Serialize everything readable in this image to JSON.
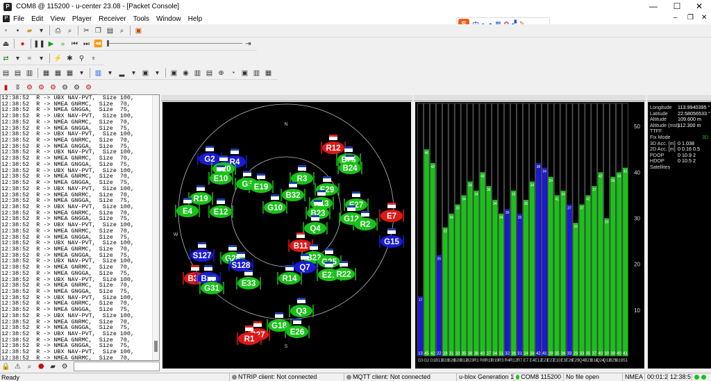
{
  "window": {
    "title": "COM8 @ 115200 - u-center 23.08 - [Packet Console]",
    "app_icon": "P",
    "minimize": "—",
    "maximize": "☐",
    "close": "✕"
  },
  "menu": {
    "items": [
      "File",
      "Edit",
      "View",
      "Player",
      "Receiver",
      "Tools",
      "Window",
      "Help"
    ],
    "mdi": {
      "minimize": "–",
      "restore": "❐",
      "close": "✕"
    }
  },
  "ime": {
    "logo": "S",
    "lang": "中"
  },
  "console": {
    "lines": [
      "12:38:52  R -> UBX NAV-PVT,  Size 100,",
      "12:38:52  R -> NMEA GNRMC,  Size  70,",
      "12:38:52  R -> NMEA GNGGA,  Size  75,",
      "12:38:52  R -> UBX NAV-PVT,  Size 100,",
      "12:38:52  R -> NMEA GNRMC,  Size  70,",
      "12:38:52  R -> NMEA GNGGA,  Size  75,",
      "12:38:52  R -> UBX NAV-PVT,  Size 100,",
      "12:38:52  R -> NMEA GNRMC,  Size  70,",
      "12:38:52  R -> NMEA GNGGA,  Size  75,",
      "12:38:52  R -> UBX NAV-PVT,  Size 100,",
      "12:38:52  R -> NMEA GNRMC,  Size  70,",
      "12:38:52  R -> NMEA GNGGA,  Size  75,",
      "12:38:52  R -> UBX NAV-PVT,  Size 100,",
      "12:38:52  R -> NMEA GNRMC,  Size  70,",
      "12:38:52  R -> NMEA GNGGA,  Size  75,",
      "12:38:52  R -> UBX NAV-PVT,  Size 100,",
      "12:38:52  R -> NMEA GNRMC,  Size  70,",
      "12:38:52  R -> NMEA GNGGA,  Size  75,",
      "12:38:52  R -> UBX NAV-PVT,  Size 100,",
      "12:38:52  R -> NMEA GNRMC,  Size  70,",
      "12:38:52  R -> NMEA GNGGA,  Size  75,",
      "12:38:52  R -> UBX NAV-PVT,  Size 100,",
      "12:38:52  R -> NMEA GNRMC,  Size  70,",
      "12:38:52  R -> NMEA GNGGA,  Size  75,",
      "12:38:52  R -> UBX NAV-PVT,  Size 100,",
      "12:38:52  R -> NMEA GNRMC,  Size  70,",
      "12:38:52  R -> NMEA GNGGA,  Size  75,",
      "12:38:52  R -> UBX NAV-PVT,  Size 100,",
      "12:38:52  R -> NMEA GNRMC,  Size  70,",
      "12:38:52  R -> NMEA GNGGA,  Size  75,",
      "12:38:52  R -> UBX NAV-PVT,  Size 100,",
      "12:38:52  R -> NMEA GNRMC,  Size  70,",
      "12:38:52  R -> NMEA GNGGA,  Size  75,",
      "12:38:52  R -> UBX NAV-PVT,  Size 100,",
      "12:38:52  R -> NMEA GNRMC,  Size  70,",
      "12:38:52  R -> NMEA GNGGA,  Size  75,",
      "12:38:52  R -> UBX NAV-PVT,  Size 100,",
      "12:38:52  R -> NMEA GNRMC,  Size  70,",
      "12:38:52  R -> NMEA GNGGA,  Size  75,",
      "12:38:52  R -> UBX NAV-PVT,  Size 100,",
      "12:38:52  R -> NMEA GNRMC,  Size  70,",
      "12:38:52  R -> NMEA GNGGA,  Size  75,",
      "12:38:52  R -> UBX NAV-PVT,  Size 100,",
      "12:38:52  R -> NMEA GNRMC,  Size  70,"
    ]
  },
  "sky": {
    "compass": [
      "N",
      "W",
      "S"
    ],
    "satellites": [
      {
        "id": "G2",
        "c": "blue"
      },
      {
        "id": "R4",
        "c": "blue"
      },
      {
        "id": "B20",
        "c": "green"
      },
      {
        "id": "R12",
        "c": "red"
      },
      {
        "id": "B25",
        "c": "green"
      },
      {
        "id": "B24",
        "c": "green"
      },
      {
        "id": "E10",
        "c": "green"
      },
      {
        "id": "G5",
        "c": "green"
      },
      {
        "id": "E19",
        "c": "green"
      },
      {
        "id": "R3",
        "c": "green"
      },
      {
        "id": "E29",
        "c": "green"
      },
      {
        "id": "R19",
        "c": "green"
      },
      {
        "id": "G10",
        "c": "green"
      },
      {
        "id": "B32",
        "c": "green"
      },
      {
        "id": "R13",
        "c": "green"
      },
      {
        "id": "E27",
        "c": "green"
      },
      {
        "id": "E4",
        "c": "green"
      },
      {
        "id": "E12",
        "c": "green"
      },
      {
        "id": "B23",
        "c": "green"
      },
      {
        "id": "G12",
        "c": "green"
      },
      {
        "id": "R2",
        "c": "green"
      },
      {
        "id": "E7",
        "c": "red"
      },
      {
        "id": "Q4",
        "c": "green"
      },
      {
        "id": "G15",
        "c": "blue"
      },
      {
        "id": "B11",
        "c": "red"
      },
      {
        "id": "S127",
        "c": "blue"
      },
      {
        "id": "G28",
        "c": "green"
      },
      {
        "id": "B22",
        "c": "green"
      },
      {
        "id": "G25",
        "c": "green"
      },
      {
        "id": "S128",
        "c": "blue"
      },
      {
        "id": "Q7",
        "c": "blue"
      },
      {
        "id": "E21",
        "c": "green"
      },
      {
        "id": "R22",
        "c": "green"
      },
      {
        "id": "B30",
        "c": "red"
      },
      {
        "id": "B18",
        "c": "blue"
      },
      {
        "id": "G31",
        "c": "green"
      },
      {
        "id": "E33",
        "c": "green"
      },
      {
        "id": "R14",
        "c": "green"
      },
      {
        "id": "Q3",
        "c": "green"
      },
      {
        "id": "G18",
        "c": "green"
      },
      {
        "id": "E26",
        "c": "green"
      },
      {
        "id": "B27",
        "c": "red"
      },
      {
        "id": "R1",
        "c": "red"
      }
    ]
  },
  "chart_data": {
    "type": "bar",
    "title": "",
    "ylim": [
      0,
      55
    ],
    "yticks": [
      10,
      20,
      30,
      40,
      50
    ],
    "bars": [
      {
        "v": 13,
        "c": "blue",
        "top": "17"
      },
      {
        "v": 45,
        "c": "green",
        "top": "46"
      },
      {
        "v": 42,
        "c": "green",
        "top": "42"
      },
      {
        "v": 22,
        "c": "blue",
        "top": "26"
      },
      {
        "v": 28,
        "c": "green",
        "top": "32"
      },
      {
        "v": 31,
        "c": "green",
        "top": "34"
      },
      {
        "v": 33,
        "c": "green",
        "top": "33"
      },
      {
        "v": 35,
        "c": "green",
        "top": "34"
      },
      {
        "v": 38,
        "c": "green",
        "top": "34"
      },
      {
        "v": 36,
        "c": "green",
        "top": "34"
      },
      {
        "v": 40,
        "c": "green",
        "top": "43"
      },
      {
        "v": 37,
        "c": "green",
        "top": "36"
      },
      {
        "v": 34,
        "c": "green",
        "top": "34"
      },
      {
        "v": 31,
        "c": "green",
        "top": "34"
      },
      {
        "v": 32,
        "c": "blue",
        "top": "39"
      },
      {
        "v": 36,
        "c": "green",
        "top": "35"
      },
      {
        "v": 31,
        "c": "blue",
        "top": "33"
      },
      {
        "v": 34,
        "c": "green",
        "top": "35"
      },
      {
        "v": 38,
        "c": "green",
        "top": "34"
      },
      {
        "v": 42,
        "c": "blue",
        "top": "38"
      },
      {
        "v": 41,
        "c": "blue",
        "top": "34"
      },
      {
        "v": 39,
        "c": "green",
        "top": "34"
      },
      {
        "v": 35,
        "c": "green",
        "top": "41"
      },
      {
        "v": 36,
        "c": "green",
        "top": "34"
      },
      {
        "v": 33,
        "c": "blue",
        "top": "37"
      },
      {
        "v": 29,
        "c": "green",
        "top": "33"
      },
      {
        "v": 33,
        "c": "green",
        "top": "37"
      },
      {
        "v": 35,
        "c": "green",
        "top": "42"
      },
      {
        "v": 37,
        "c": "green",
        "top": "37"
      },
      {
        "v": 40,
        "c": "green",
        "top": "42"
      },
      {
        "v": 30,
        "c": "green",
        "top": "30"
      },
      {
        "v": 39,
        "c": "green",
        "top": "36"
      },
      {
        "v": 40,
        "c": "green",
        "top": "34"
      },
      {
        "v": 41,
        "c": "green",
        "top": "42"
      }
    ],
    "bottom_labels": [
      "G3",
      "G2",
      "G1",
      "B13",
      "B31",
      "B26",
      "B20",
      "B12",
      "B23",
      "R1",
      "R8",
      "R11",
      "R19",
      "R3",
      "R4",
      "R12",
      "R7",
      "E7",
      "E4",
      "E12",
      "E21",
      "E27",
      "E10",
      "E3",
      "E26",
      "E29",
      "Q4",
      "B21",
      "B18",
      "Q24",
      "Q12",
      "B25",
      "B19",
      "S1"
    ]
  },
  "nav": {
    "rows": [
      {
        "label": "Longitude",
        "value": "113.9940395 °"
      },
      {
        "label": "Latitude",
        "value": "22.58056533 °"
      },
      {
        "label": "Altitude",
        "value": "109.600 m"
      },
      {
        "label": "Altitude (msl)",
        "value": "112.300 m"
      },
      {
        "label": "TTFF",
        "value": ""
      },
      {
        "label": "Fix Mode",
        "value": "3D"
      },
      {
        "label": "3D Acc. [m]",
        "value": "0  1.038"
      },
      {
        "label": "2D Acc. [m]",
        "value": "0  0.16  0.5"
      },
      {
        "label": "PDOP",
        "value": "0  10.9  2"
      },
      {
        "label": "HDOP",
        "value": "0  10.5  2"
      },
      {
        "label": "Satellites",
        "value": ""
      }
    ]
  },
  "status": {
    "ready": "Ready",
    "ntrip": "NTRIP client: Not connected",
    "mqtt": "MQTT client: Not connected",
    "gen": "u-blox Generation 1",
    "port": "COM8 115200",
    "file": "No file open",
    "protocol": "NMEA",
    "elapsed": "00:01:2",
    "clock": "12:38:5"
  },
  "colors": {
    "green": "#19c219",
    "blue": "#1a1ad6",
    "red": "#e01818"
  }
}
